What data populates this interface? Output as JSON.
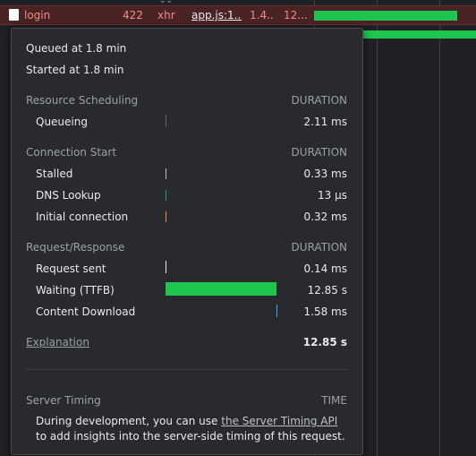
{
  "network_row": {
    "name": "login",
    "status": "422",
    "type": "xhr",
    "initiator": "app.js:1...",
    "size": "1.4...",
    "time": "12..."
  },
  "timing": {
    "queued_at": "Queued at 1.8 min",
    "started_at": "Started at 1.8 min",
    "sections": {
      "scheduling": {
        "title": "Resource Scheduling",
        "duration_header": "DURATION",
        "rows": [
          {
            "label": "Queueing",
            "value": "2.11 ms"
          }
        ]
      },
      "connection": {
        "title": "Connection Start",
        "duration_header": "DURATION",
        "rows": [
          {
            "label": "Stalled",
            "value": "0.33 ms"
          },
          {
            "label": "DNS Lookup",
            "value": "13 µs"
          },
          {
            "label": "Initial connection",
            "value": "0.32 ms"
          }
        ]
      },
      "request": {
        "title": "Request/Response",
        "duration_header": "DURATION",
        "rows": [
          {
            "label": "Request sent",
            "value": "0.14 ms"
          },
          {
            "label": "Waiting (TTFB)",
            "value": "12.85 s"
          },
          {
            "label": "Content Download",
            "value": "1.58 ms"
          }
        ]
      }
    },
    "explanation_label": "Explanation",
    "total": "12.85 s",
    "server_timing": {
      "title": "Server Timing",
      "header": "TIME",
      "desc_before": "During development, you can use ",
      "link": "the Server Timing API",
      "desc_after": " to add insights into the server-side timing of this request."
    }
  },
  "colors": {
    "ttfb": "#1ec54f",
    "queueing": "#5f6368",
    "stalled": "#bdc1c6",
    "dns": "#1e9e8c",
    "initial_connection": "#e8914a",
    "request_sent": "#e8eaed",
    "content_download": "#4a9fe8"
  }
}
